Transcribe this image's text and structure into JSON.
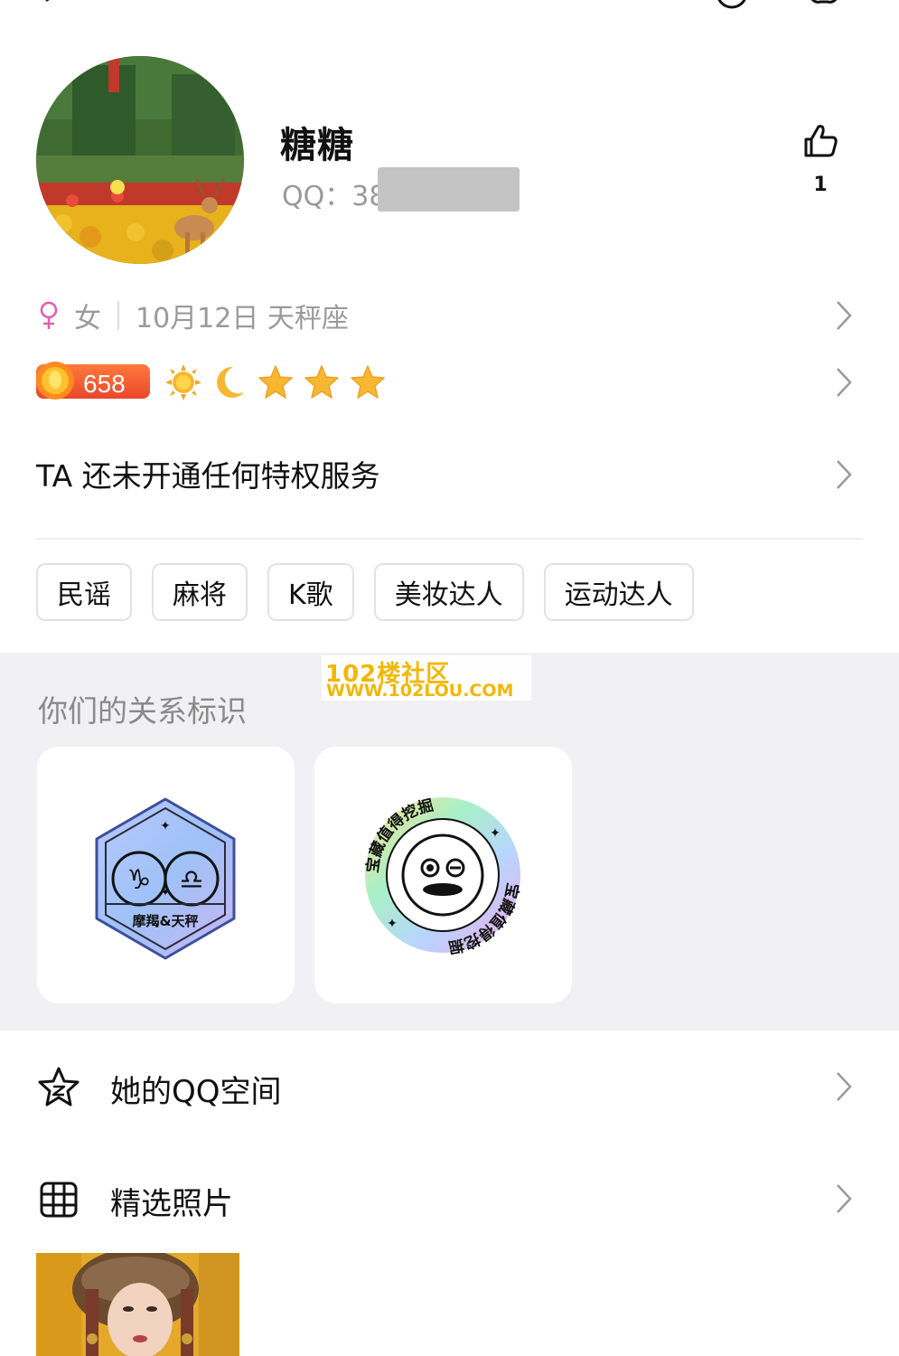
{
  "profile": {
    "nickname": "糖糖",
    "qq_label": "QQ：38",
    "likes": "1"
  },
  "info": {
    "gender_symbol": "♀",
    "gender": "女",
    "birthday_sign": "10月12日 天秤座"
  },
  "level": {
    "value": "658",
    "icons": [
      "sun-icon",
      "moon-icon",
      "star-icon",
      "star-icon",
      "star-icon"
    ]
  },
  "privilege": {
    "text": "TA 还未开通任何特权服务"
  },
  "tags": [
    "民谣",
    "麻将",
    "K歌",
    "美妆达人",
    "运动达人"
  ],
  "relationship": {
    "title": "你们的关系标识",
    "cards": [
      {
        "badge": "摩羯&天秤",
        "symbols": "♑ ♎"
      },
      {
        "badge_text": "宝藏值得挖掘"
      }
    ]
  },
  "watermark": {
    "line1": "102楼社区",
    "line2": "WWW.102LOU.COM"
  },
  "menu": {
    "qzone": "她的QQ空间",
    "photos": "精选照片"
  },
  "colors": {
    "accent_level": "#e9472a",
    "gender_pink": "#e85ab0",
    "section_bg": "#f1f1f3",
    "watermark": "#f2b705"
  }
}
